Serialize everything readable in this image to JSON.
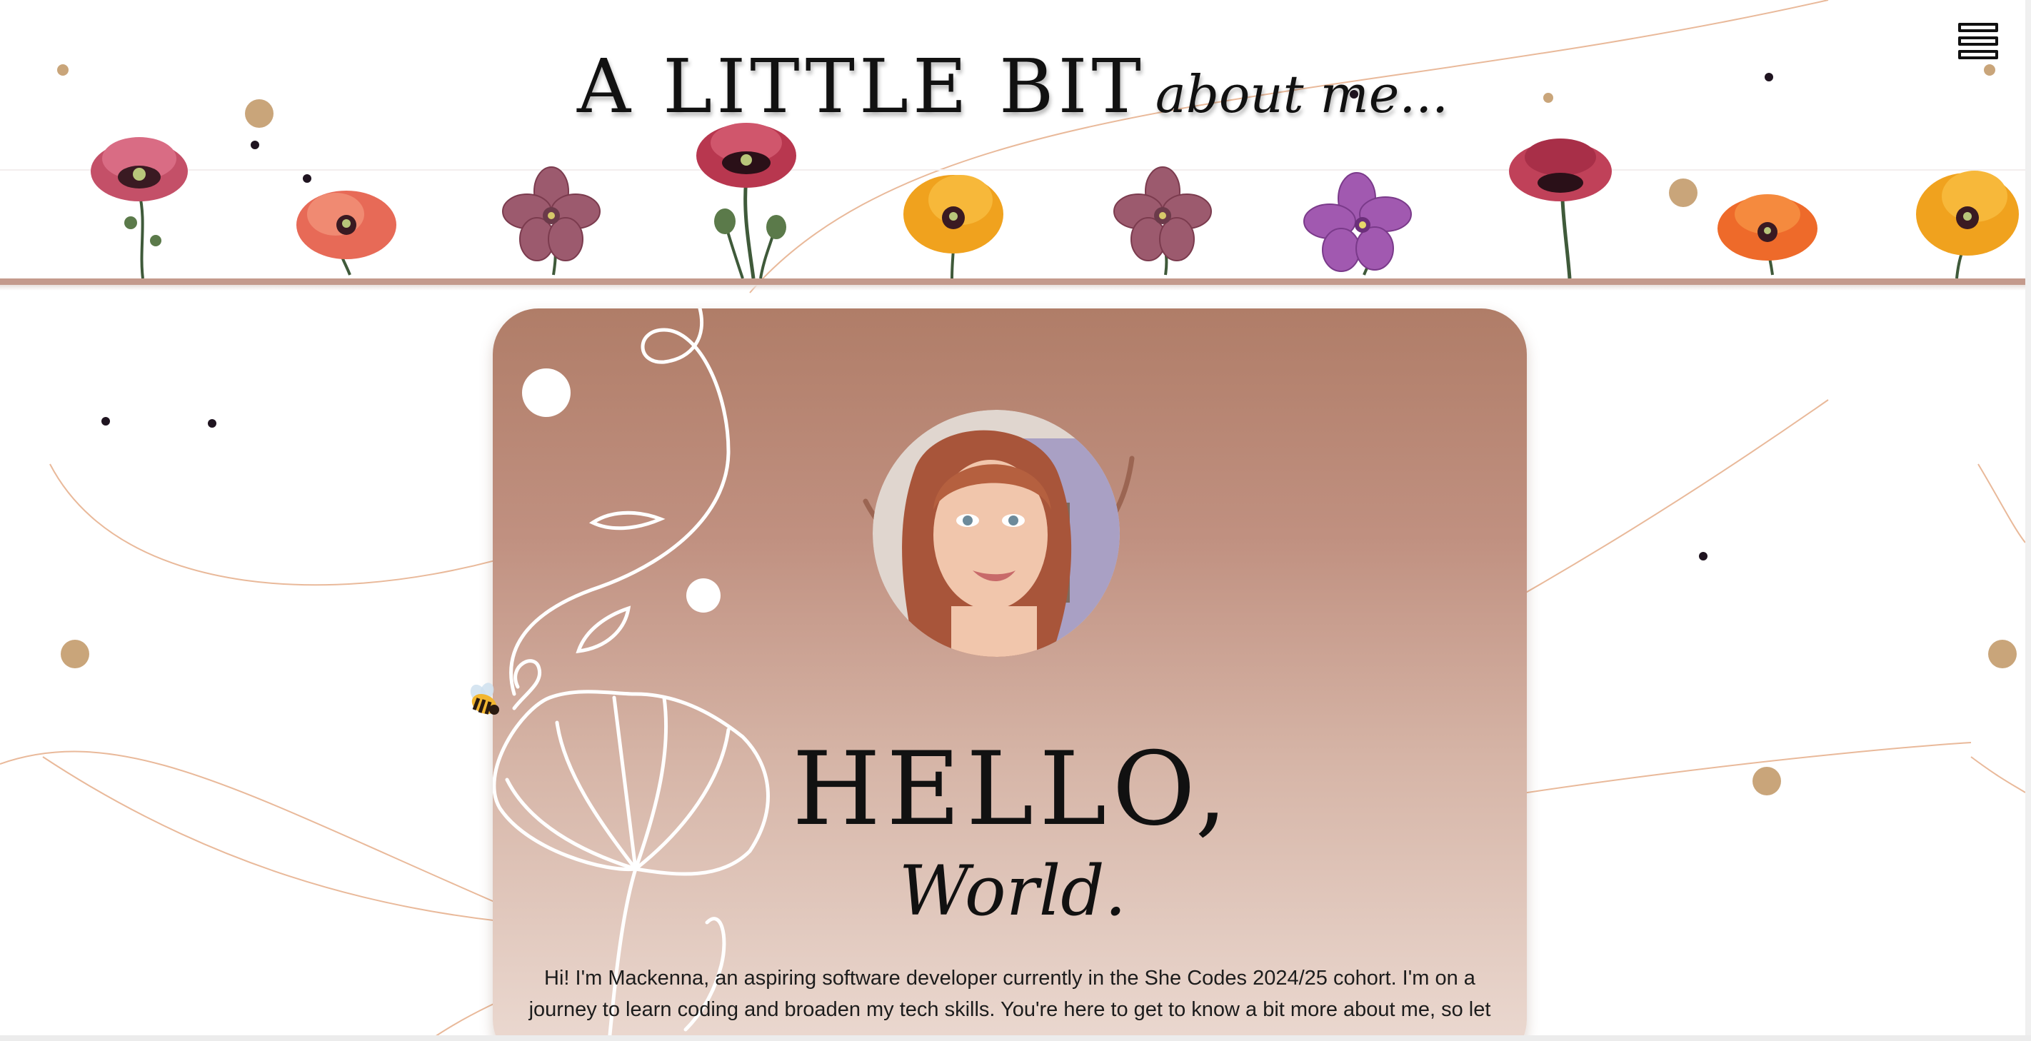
{
  "header": {
    "title_main": "A LITTLE BIT",
    "title_script": "about me...",
    "menu_icon": "hamburger-menu-icon"
  },
  "hero": {
    "greeting": "HELLO,",
    "greeting_sub": "World.",
    "intro": "Hi! I'm Mackenna, an aspiring software developer currently in the She Codes 2024/25 cohort. I'm on a journey to learn coding and broaden my tech skills. You're here to get to know a bit more about me, so let"
  },
  "colors": {
    "accent": "#c49a8c",
    "card_top": "#b07d68",
    "card_bottom": "#ecdbd3",
    "dot_gold": "#c9a57a",
    "dot_dark": "#1f1420"
  },
  "icons": {
    "menu": "hamburger-menu-icon",
    "bee": "bee-icon",
    "flower": "poppy-flower-icon"
  }
}
